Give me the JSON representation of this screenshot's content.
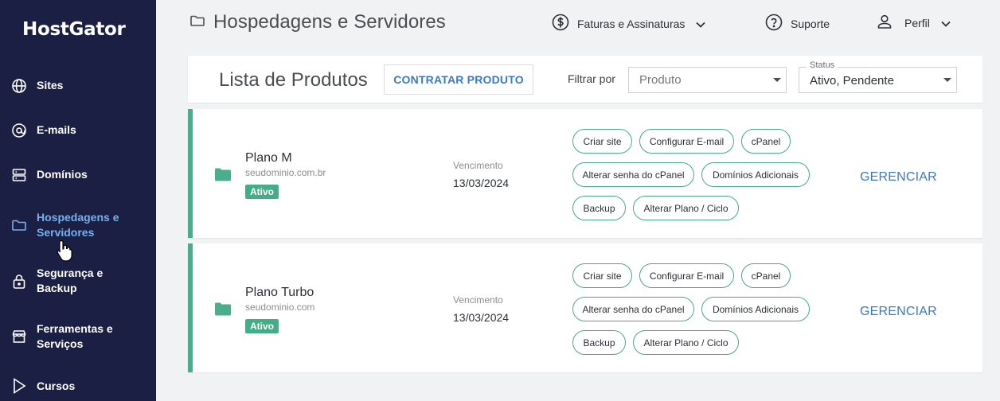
{
  "app": {
    "logo": "HostGator"
  },
  "sidebar": {
    "items": [
      {
        "label": "Sites",
        "icon": "globe-icon"
      },
      {
        "label": "E-mails",
        "icon": "at-icon"
      },
      {
        "label": "Domínios",
        "icon": "server-icon"
      },
      {
        "label_line1": "Hospedagens e",
        "label_line2": "Servidores",
        "icon": "folder-icon",
        "active": true
      },
      {
        "label_line1": "Segurança e",
        "label_line2": "Backup",
        "icon": "lock-icon"
      },
      {
        "label_line1": "Ferramentas e",
        "label_line2": "Serviços",
        "icon": "store-icon"
      },
      {
        "label": "Cursos",
        "icon": "play-icon"
      }
    ]
  },
  "header": {
    "page_title": "Hospedagens e Servidores",
    "billing": "Faturas e Assinaturas",
    "support": "Suporte",
    "profile": "Perfil"
  },
  "toolbar": {
    "title": "Lista de Produtos",
    "contract_button": "CONTRATAR PRODUTO",
    "filter_label": "Filtrar por",
    "product_select": {
      "placeholder": "Produto"
    },
    "status_select": {
      "legend": "Status",
      "value": "Ativo, Pendente"
    }
  },
  "products": [
    {
      "name": "Plano M",
      "domain": "seudominio.com.br",
      "status": "Ativo",
      "due_label": "Vencimento",
      "due_date": "13/03/2024",
      "actions": [
        "Criar site",
        "Configurar E-mail",
        "cPanel",
        "Alterar senha do cPanel",
        "Domínios Adicionais",
        "Backup",
        "Alterar Plano / Ciclo"
      ],
      "manage": "GERENCIAR"
    },
    {
      "name": "Plano Turbo",
      "domain": "seudominio.com",
      "status": "Ativo",
      "due_label": "Vencimento",
      "due_date": "13/03/2024",
      "actions": [
        "Criar site",
        "Configurar E-mail",
        "cPanel",
        "Alterar senha do cPanel",
        "Domínios Adicionais",
        "Backup",
        "Alterar Plano / Ciclo"
      ],
      "manage": "GERENCIAR"
    }
  ],
  "colors": {
    "sidebar_bg": "#1c1f44",
    "active_nav": "#74b1ef",
    "accent_green": "#48ad8a",
    "link_blue": "#3c79c4"
  }
}
